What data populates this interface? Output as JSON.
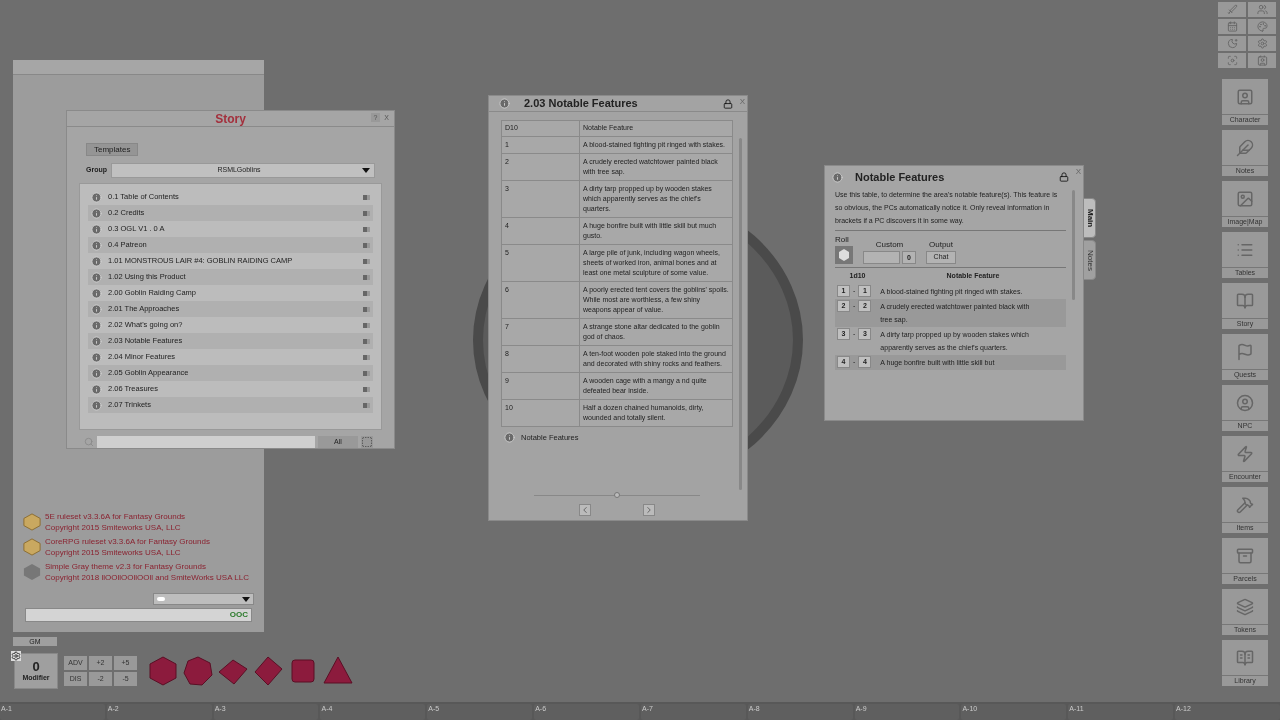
{
  "story": {
    "title": "Story",
    "help": "?",
    "close": "X",
    "templates_button": "Templates",
    "group_label": "Group",
    "group_value": "RSMLGoblins",
    "filter_button": "All",
    "entries": [
      "0.1 Table of Contents",
      "0.2 Credits",
      "0.3 OGL V1 . 0 A",
      "0.4 Patreon",
      "1.01 MONSTROUS LAIR #4: GOBLIN RAIDING CAMP",
      "1.02 Using this Product",
      "2.00 Goblin Raiding Camp",
      "2.01 The Approaches",
      "2.02 What's going on?",
      "2.03 Notable Features",
      "2.04 Minor Features",
      "2.05 Goblin Appearance",
      "2.06 Treasures",
      "2.07 Trinkets"
    ]
  },
  "table_window": {
    "title": "2.03 Notable Features",
    "close": "X",
    "columns": [
      "D10",
      "Notable Feature"
    ],
    "rows": [
      {
        "roll": "1",
        "feature": "A blood-stained fighting pit ringed with stakes."
      },
      {
        "roll": "2",
        "feature": "A crudely erected watchtower painted black with tree sap."
      },
      {
        "roll": "3",
        "feature": "A dirty tarp propped up by wooden stakes which apparently serves as the chief's quarters."
      },
      {
        "roll": "4",
        "feature": "A huge bonfire built with little skill but much gusto."
      },
      {
        "roll": "5",
        "feature": "A large pile of junk, including wagon wheels, sheets of worked iron, animal bones and at least one metal sculpture of some value."
      },
      {
        "roll": "6",
        "feature": "A poorly erected tent covers the goblins' spoils. While most are worthless, a few shiny weapons appear of value."
      },
      {
        "roll": "7",
        "feature": "A strange stone altar dedicated to the goblin god of chaos."
      },
      {
        "roll": "8",
        "feature": "A ten-foot wooden pole staked into the ground and decorated with shiny rocks and feathers."
      },
      {
        "roll": "9",
        "feature": "A wooden cage with a mangy a nd quite defeated bear inside."
      },
      {
        "roll": "10",
        "feature": "Half a dozen chained humanoids, dirty, wounded and totally silent."
      }
    ],
    "link": "Notable Features",
    "zoom": {
      "level": 0.5
    }
  },
  "notable_window": {
    "title": "Notable Features",
    "close": "X",
    "description": "Use this table, to determine the area's notable feature(s). This feature is so obvious, the PCs automatically notice it. Only reveal information in brackets if a PC discovers it in some way.",
    "roll_label": "Roll",
    "custom_label": "Custom",
    "custom_value": "0",
    "output_label": "Output",
    "output_button": "Chat",
    "tabs": [
      {
        "label": "Main",
        "selected": true
      },
      {
        "label": "Notes",
        "selected": false
      }
    ],
    "columns": [
      "1d10",
      "Notable Feature"
    ],
    "rows": [
      {
        "from": "1",
        "separator": "-",
        "to": "1",
        "result": "A blood-stained fighting pit ringed with stakes."
      },
      {
        "from": "2",
        "separator": "-",
        "to": "2",
        "result": "A crudely erected watchtower painted black with tree sap."
      },
      {
        "from": "3",
        "separator": "-",
        "to": "3",
        "result": "A dirty tarp propped up by wooden stakes which apparently serves as the chief's quarters."
      },
      {
        "from": "4",
        "separator": "-",
        "to": "4",
        "result": "A huge bonfire built with little skill but"
      }
    ]
  },
  "chat": {
    "messages": [
      {
        "kind": "ruleset",
        "line1": "5E ruleset v3.3.6A for Fantasy Grounds",
        "line2": "Copyright 2015 Smiteworks USA, LLC"
      },
      {
        "kind": "ruleset",
        "line1": "CoreRPG ruleset v3.3.6A for Fantasy Grounds",
        "line2": "Copyright 2015 Smiteworks USA, LLC"
      },
      {
        "kind": "theme",
        "line1": "Simple Gray theme v2.3 for Fantasy Grounds",
        "line2": "Copyright 2018 llOOllOOllOOll and SmiteWorks USA LLC"
      }
    ],
    "mode": "OOC",
    "identity": "GM"
  },
  "modifier": {
    "value": "0",
    "label": "Modifier",
    "buttons": [
      "ADV",
      "+2",
      "+5",
      "DIS",
      "-2",
      "-5"
    ]
  },
  "sidebar": {
    "items": [
      "Character",
      "Notes",
      "Image|Map",
      "Tables",
      "Story",
      "Quests",
      "NPC",
      "Encounter",
      "Items",
      "Parcels",
      "Tokens",
      "Library"
    ]
  },
  "hotkeys": [
    "A-1",
    "A-2",
    "A-3",
    "A-4",
    "A-5",
    "A-6",
    "A-7",
    "A-8",
    "A-9",
    "A-10",
    "A-11",
    "A-12"
  ]
}
